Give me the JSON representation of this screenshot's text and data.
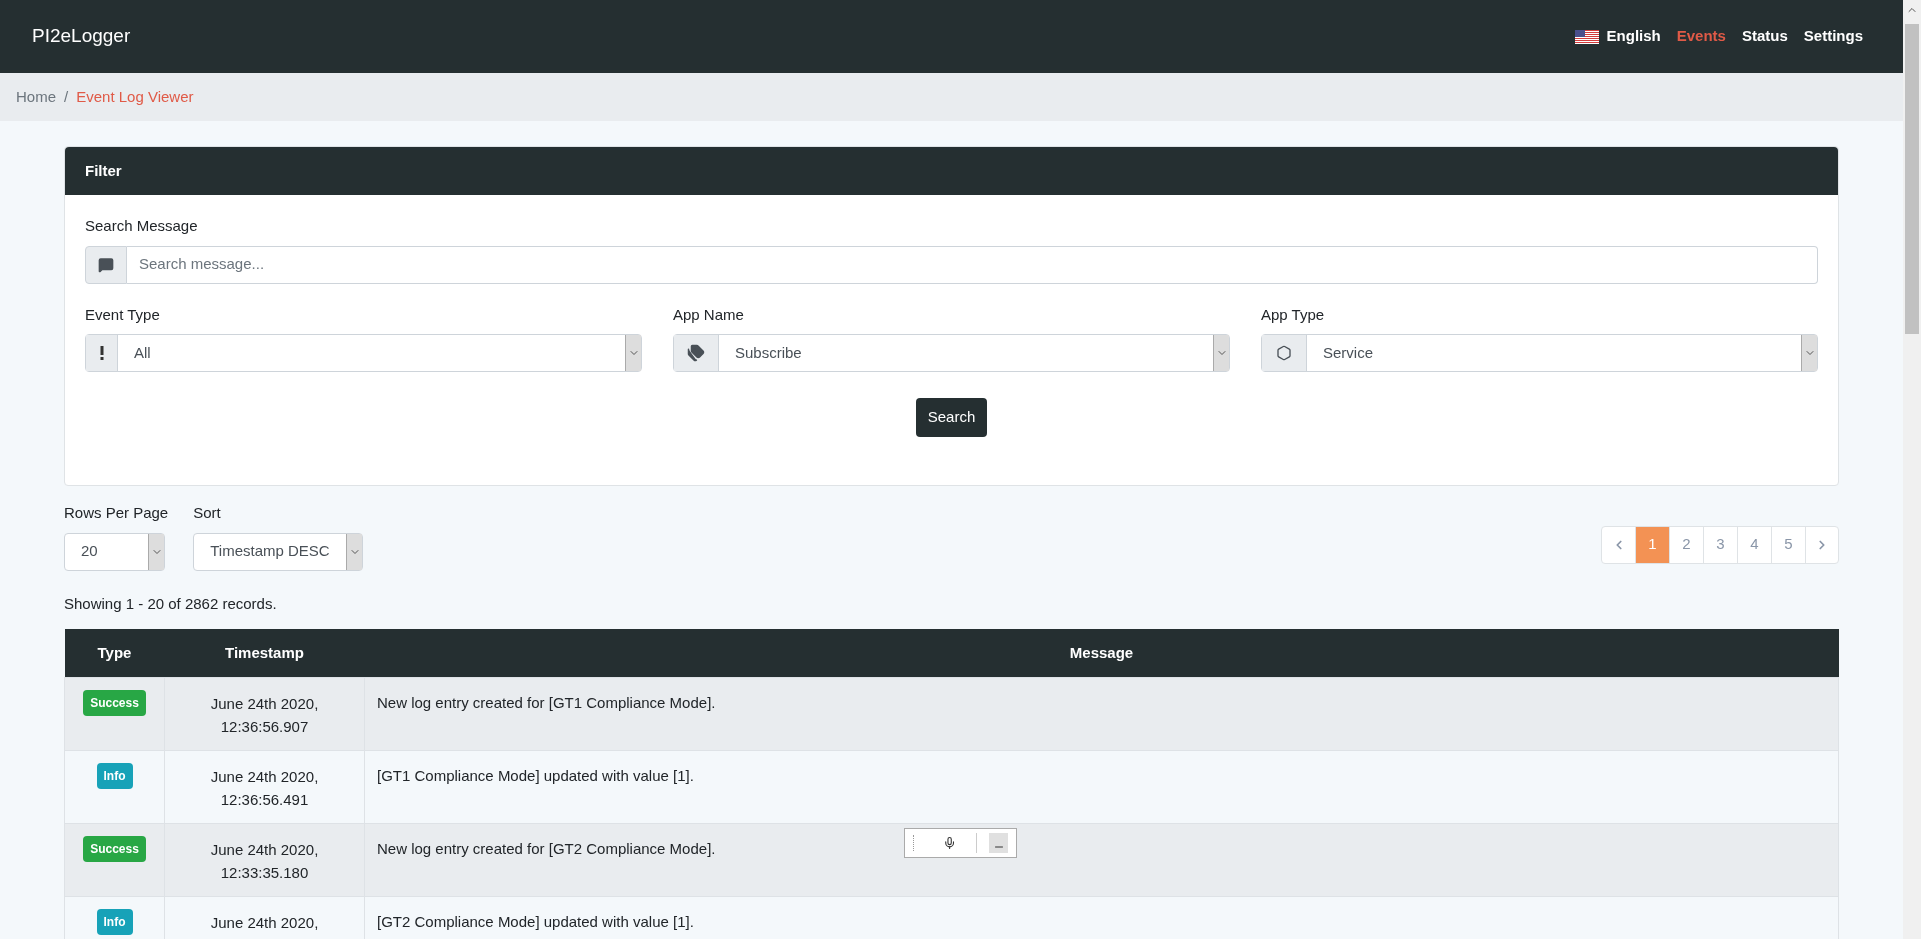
{
  "navbar": {
    "brand": "PI2eLogger",
    "items": [
      {
        "kind": "language",
        "label": "English",
        "selected": false
      },
      {
        "kind": "link",
        "label": "Events",
        "selected": true
      },
      {
        "kind": "link",
        "label": "Status",
        "selected": false
      },
      {
        "kind": "link",
        "label": "Settings",
        "selected": false
      }
    ]
  },
  "breadcrumb": [
    {
      "label": "Home",
      "selected": false
    },
    {
      "label": "Event Log Viewer",
      "selected": true
    }
  ],
  "breadcrumb_separator": "/",
  "filter": {
    "title": "Filter",
    "search": {
      "label": "Search Message",
      "placeholder": "Search message..."
    },
    "selects": [
      {
        "label": "Event Type",
        "value": "All"
      },
      {
        "label": "App Name",
        "value": "Subscribe"
      },
      {
        "label": "App Type",
        "value": "Service"
      }
    ],
    "button": "Search"
  },
  "rows_per_page": {
    "label": "Rows Per Page",
    "value": "20"
  },
  "sort": {
    "label": "Sort",
    "value": "Timestamp DESC"
  },
  "pagination": [
    {
      "label": "1",
      "selected": true
    },
    {
      "label": "2",
      "selected": false
    },
    {
      "label": "3",
      "selected": false
    },
    {
      "label": "4",
      "selected": false
    },
    {
      "label": "5",
      "selected": false
    }
  ],
  "summary": "Showing 1 - 20 of 2862 records.",
  "table": {
    "columns": [
      "Type",
      "Timestamp",
      "Message"
    ],
    "rows": [
      {
        "type": {
          "kind": "success",
          "label": "Success"
        },
        "timestamp": [
          "June 24th 2020,",
          "12:36:56.907"
        ],
        "message": "New log entry created for [GT1 Compliance Mode]."
      },
      {
        "type": {
          "kind": "info",
          "label": "Info"
        },
        "timestamp": [
          "June 24th 2020,",
          "12:36:56.491"
        ],
        "message": "[GT1 Compliance Mode] updated with value [1]."
      },
      {
        "type": {
          "kind": "success",
          "label": "Success"
        },
        "timestamp": [
          "June 24th 2020,",
          "12:33:35.180"
        ],
        "message": "New log entry created for [GT2 Compliance Mode]."
      },
      {
        "type": {
          "kind": "info",
          "label": "Info"
        },
        "timestamp": [
          "June 24th 2020,"
        ],
        "message": "[GT2 Compliance Mode] updated with value [1]."
      }
    ]
  }
}
